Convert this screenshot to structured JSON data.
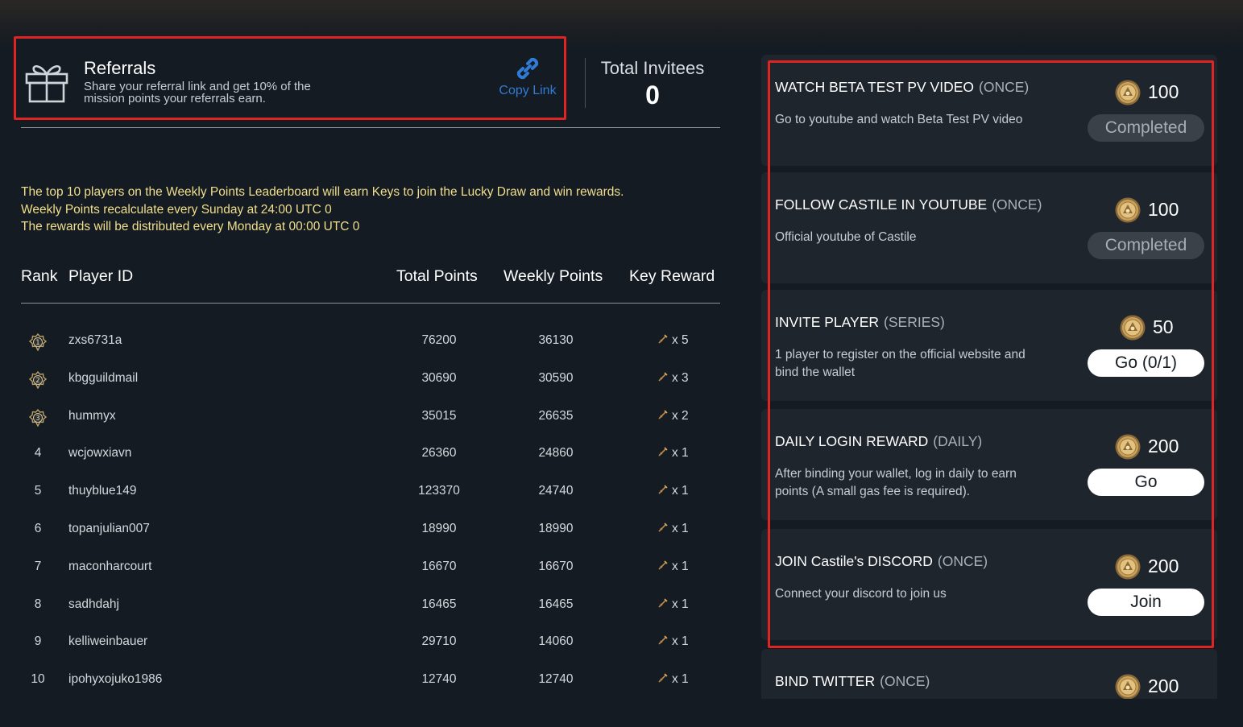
{
  "referral": {
    "title": "Referrals",
    "description": "Share your referral link and get 10% of the mission points your referrals earn.",
    "copy_link_label": "Copy Link",
    "total_invitees_label": "Total Invitees",
    "total_invitees_value": "0"
  },
  "notice": {
    "lines": [
      "The top 10 players on the Weekly Points Leaderboard will earn Keys to join the Lucky Draw and win rewards.",
      "Weekly Points recalculate every Sunday at 24:00 UTC 0",
      "The rewards will be distributed every Monday at 00:00 UTC 0"
    ]
  },
  "leaderboard": {
    "headers": {
      "rank": "Rank",
      "player": "Player ID",
      "total": "Total Points",
      "weekly": "Weekly Points",
      "key": "Key Reward"
    },
    "rows": [
      {
        "rank": "1",
        "player": "zxs6731a",
        "total": "76200",
        "weekly": "36130",
        "key": "x 5"
      },
      {
        "rank": "2",
        "player": "kbgguildmail",
        "total": "30690",
        "weekly": "30590",
        "key": "x 3"
      },
      {
        "rank": "3",
        "player": "hummyx",
        "total": "35015",
        "weekly": "26635",
        "key": "x 2"
      },
      {
        "rank": "4",
        "player": "wcjowxiavn",
        "total": "26360",
        "weekly": "24860",
        "key": "x 1"
      },
      {
        "rank": "5",
        "player": "thuyblue149",
        "total": "123370",
        "weekly": "24740",
        "key": "x 1"
      },
      {
        "rank": "6",
        "player": "topanjulian007",
        "total": "18990",
        "weekly": "18990",
        "key": "x 1"
      },
      {
        "rank": "7",
        "player": "maconharcourt",
        "total": "16670",
        "weekly": "16670",
        "key": "x 1"
      },
      {
        "rank": "8",
        "player": "sadhdahj",
        "total": "16465",
        "weekly": "16465",
        "key": "x 1"
      },
      {
        "rank": "9",
        "player": "kelliweinbauer",
        "total": "29710",
        "weekly": "14060",
        "key": "x 1"
      },
      {
        "rank": "10",
        "player": "ipohyxojuko1986",
        "total": "12740",
        "weekly": "12740",
        "key": "x 1"
      }
    ]
  },
  "missions": [
    {
      "title": "WATCH BETA TEST PV VIDEO",
      "type": "(ONCE)",
      "desc": "Go to youtube and watch Beta Test PV video",
      "points": "100",
      "button": "Completed",
      "state": "done"
    },
    {
      "title": "FOLLOW CASTILE IN YOUTUBE",
      "type": "(ONCE)",
      "desc": "Official youtube of Castile",
      "points": "100",
      "button": "Completed",
      "state": "done"
    },
    {
      "title": "INVITE PLAYER",
      "type": "(SERIES)",
      "desc": "1 player to register on the official website and bind the wallet",
      "points": "50",
      "button": "Go (0/1)",
      "state": "go"
    },
    {
      "title": "DAILY LOGIN REWARD",
      "type": "(DAILY)",
      "desc": "After binding your wallet, log in daily to earn points (A small gas fee is required).",
      "points": "200",
      "button": "Go",
      "state": "go"
    },
    {
      "title": "JOIN Castile's DISCORD",
      "type": "(ONCE)",
      "desc": "Connect your discord to join us",
      "points": "200",
      "button": "Join",
      "state": "go"
    },
    {
      "title": "BIND TWITTER",
      "type": "(ONCE)",
      "desc": "",
      "points": "200",
      "button": "",
      "state": "none"
    }
  ],
  "colors": {
    "background": "#141b22",
    "card": "#1e252c",
    "highlight_border": "#e02323",
    "notice_text": "#f1df8c",
    "link_blue": "#2f7bd6",
    "coin_gold": "#c9a15a"
  },
  "icons": {
    "gift": "gift-icon",
    "link": "link-icon",
    "medal": "medal-icon",
    "key": "key-icon",
    "coin": "coin-icon"
  }
}
